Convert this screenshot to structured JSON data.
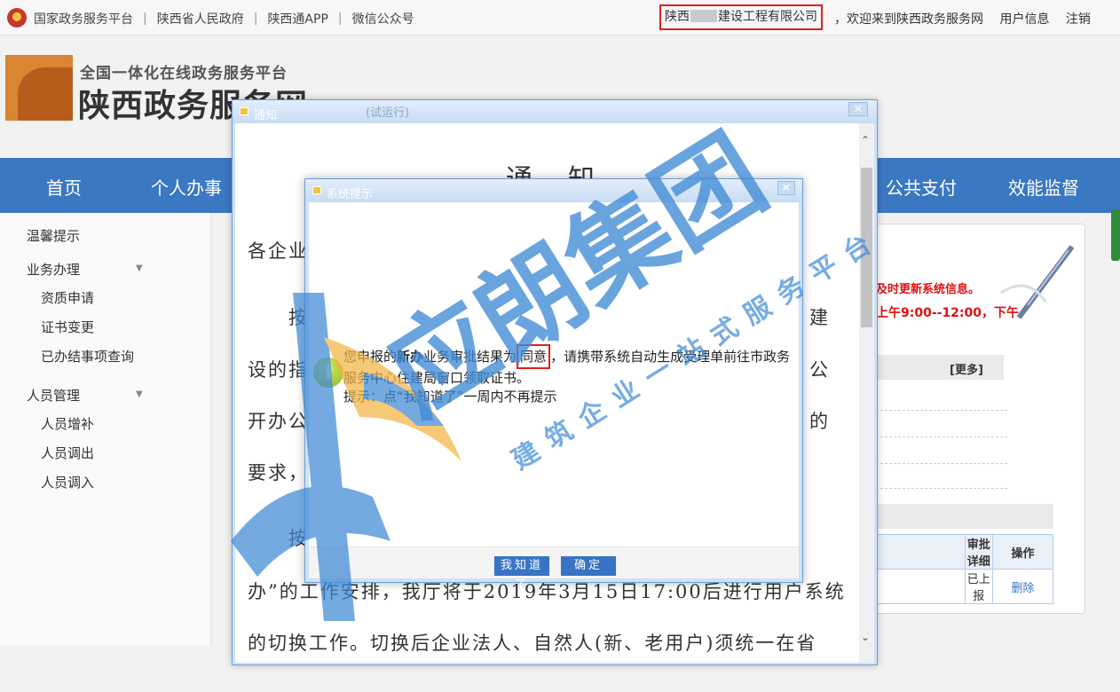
{
  "topbar": {
    "links": [
      "国家政务服务平台",
      "陕西省人民政府",
      "陕西通APP",
      "微信公众号"
    ],
    "separator": "|",
    "company_prefix": "陕西",
    "company_suffix": "建设工程有限公司",
    "welcome": "，欢迎来到陕西政务服务网",
    "user_info": "用户信息",
    "logout": "注销"
  },
  "logo": {
    "subtitle": "全国一体化在线政务服务平台",
    "title": "陕西政务服务网"
  },
  "nav": {
    "items": [
      "首页",
      "个人办事",
      "公共支付",
      "效能监督"
    ]
  },
  "sidebar": {
    "tip": "温馨提示",
    "group1": "业务办理",
    "group1_items": [
      "资质申请",
      "证书变更",
      "已办结事项查询"
    ],
    "group2": "人员管理",
    "group2_items": [
      "人员增补",
      "人员调出",
      "人员调入"
    ]
  },
  "right_panel": {
    "red_line1": "及时更新系统信息。",
    "red_line2": "上午9:00--12:00，下午",
    "more": "[更多]",
    "table_headers": [
      "审批详细",
      "操作"
    ],
    "table_row": [
      "已上报",
      "删除"
    ]
  },
  "notice": {
    "window_title": "通知",
    "trial": "(试运行)",
    "heading": "通知",
    "lines_left": [
      "各企业",
      "按",
      "设的指",
      "开办公",
      "要求，",
      "按",
      "办”的工作安排，我厅将于2019年3月15日17:00后进行用户系统",
      "的切换工作。切换后企业法人、自然人(新、老用户)须统一在省"
    ],
    "lines_right": [
      "建",
      "公",
      "的"
    ]
  },
  "dialog": {
    "title": "系统提示",
    "msg_part1": "您申报的",
    "msg_bold": "新办",
    "msg_part2": "业务审批结果为",
    "msg_agree": "同意",
    "msg_part3": "，请携带系统自动生成受理单前往市政务服务中心住建局窗口领取证书。",
    "msg_hint": "提示：点“我知道了”一周内不再提示",
    "btn_know": "我知道了",
    "btn_ok": "确定"
  },
  "watermark": {
    "big": "应朗集团",
    "small": "建筑企业一站式服务平台"
  },
  "colors": {
    "nav_blue": "#3a78c2",
    "button_blue": "#3873c4",
    "highlight_red": "#e02020",
    "watermark_blue": "#3f8ad6"
  }
}
